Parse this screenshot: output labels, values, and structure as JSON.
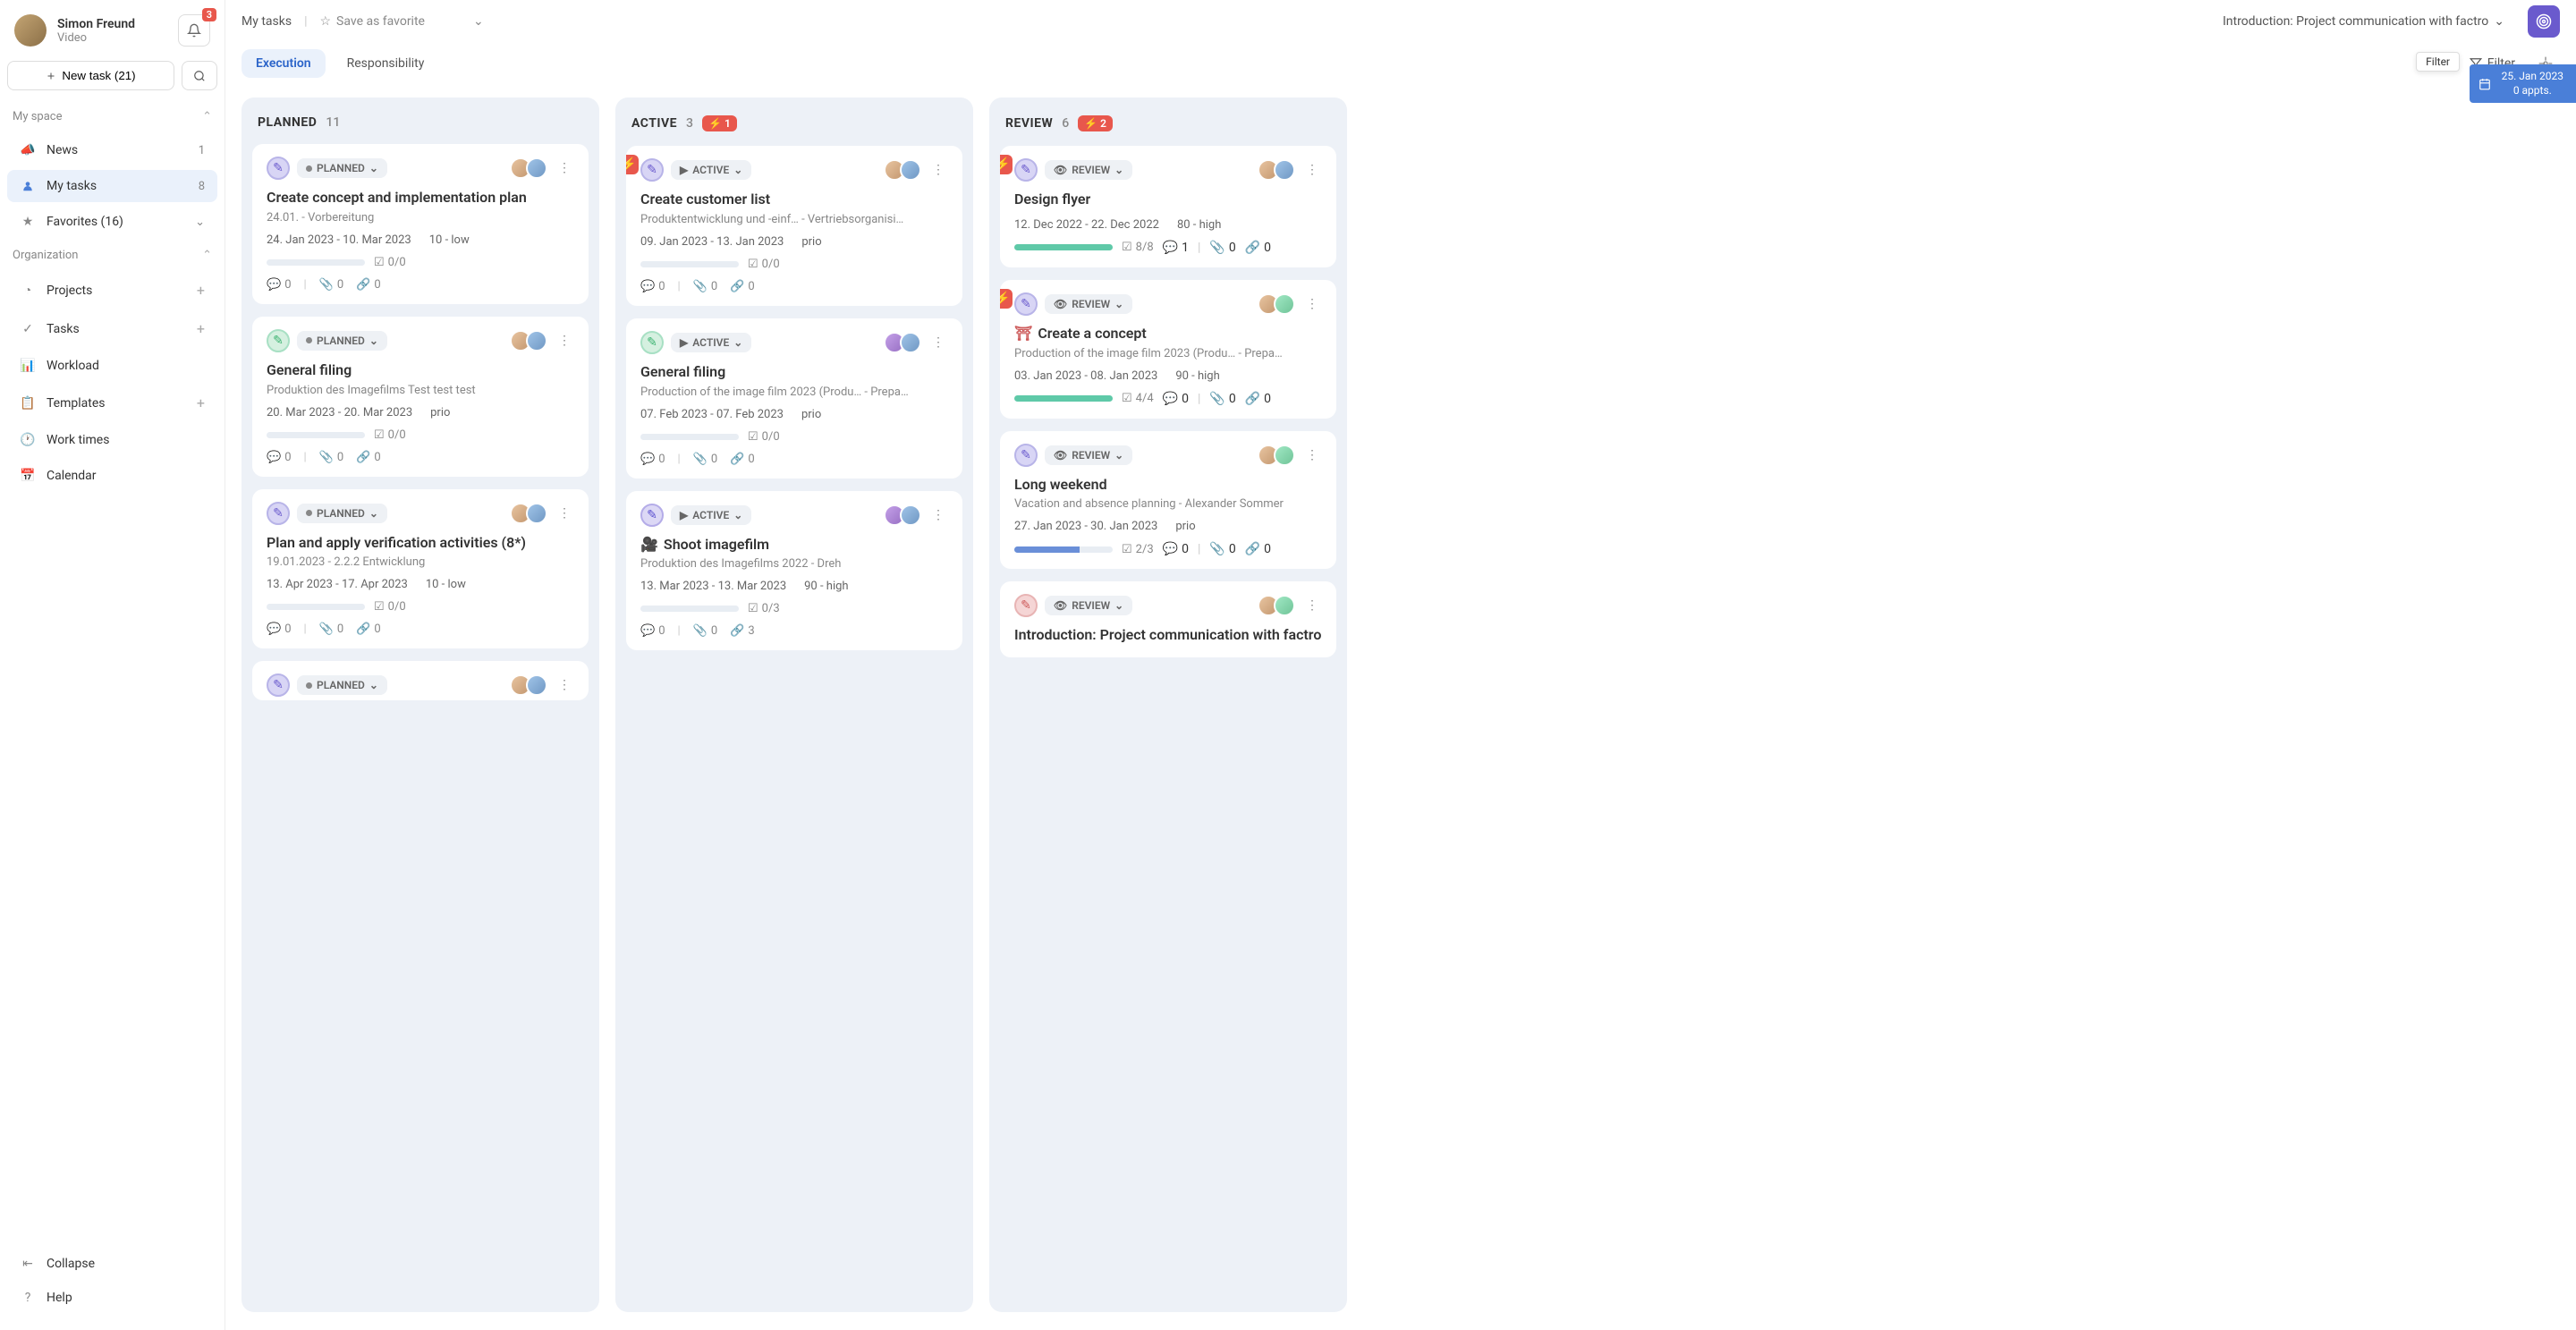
{
  "user": {
    "name": "Simon Freund",
    "subtitle": "Video",
    "bell_badge": "3"
  },
  "sidebar": {
    "new_task": "New task (21)",
    "sections": {
      "my_space": {
        "title": "My space"
      },
      "organization": {
        "title": "Organization"
      }
    },
    "items": {
      "news": {
        "label": "News",
        "badge": "1"
      },
      "my_tasks": {
        "label": "My tasks",
        "badge": "8"
      },
      "favorites": {
        "label": "Favorites (16)"
      },
      "projects": {
        "label": "Projects"
      },
      "tasks": {
        "label": "Tasks"
      },
      "workload": {
        "label": "Workload"
      },
      "templates": {
        "label": "Templates"
      },
      "work_times": {
        "label": "Work times"
      },
      "calendar": {
        "label": "Calendar"
      },
      "collapse": {
        "label": "Collapse"
      },
      "help": {
        "label": "Help"
      }
    }
  },
  "topbar": {
    "crumb": "My tasks",
    "save_favorite": "Save as favorite",
    "board_title": "Introduction: Project communication with factro"
  },
  "tabs": {
    "execution": "Execution",
    "responsibility": "Responsibility"
  },
  "filter": {
    "label": "Filter",
    "tooltip": "Filter"
  },
  "date_panel": {
    "date": "25. Jan 2023",
    "appts": "0 appts."
  },
  "columns": {
    "planned": {
      "title": "PLANNED",
      "count": "11",
      "status_label": "PLANNED"
    },
    "active": {
      "title": "ACTIVE",
      "count": "3",
      "alert": "1",
      "status_label": "ACTIVE"
    },
    "review": {
      "title": "REVIEW",
      "count": "6",
      "alert": "2",
      "status_label": "REVIEW"
    }
  },
  "cards": {
    "p1": {
      "title": "Create concept and implementation plan",
      "sub": "24.01. - Vorbereitung",
      "dates": "24. Jan 2023 - 10. Mar 2023",
      "prio": "10 - low",
      "check": "0/0",
      "comments": "0",
      "attach": "0",
      "links": "0"
    },
    "p2": {
      "title": "General filing",
      "sub": "Produktion des Imagefilms Test test test",
      "dates": "20. Mar 2023 - 20. Mar 2023",
      "prio": "prio",
      "check": "0/0",
      "comments": "0",
      "attach": "0",
      "links": "0"
    },
    "p3": {
      "title": "Plan and apply verification activities (8*)",
      "sub": "19.01.2023 - 2.2.2 Entwicklung",
      "dates": "13. Apr 2023 - 17. Apr 2023",
      "prio": "10 - low",
      "check": "0/0",
      "comments": "0",
      "attach": "0",
      "links": "0"
    },
    "a1": {
      "title": "Create customer list",
      "sub": "Produktentwicklung und -einf…  - Vertriebsorganisi…",
      "dates": "09. Jan 2023 - 13. Jan 2023",
      "prio": "prio",
      "check": "0/0",
      "comments": "0",
      "attach": "0",
      "links": "0"
    },
    "a2": {
      "title": "General filing",
      "sub": "Production of the image film 2023 (Produ…  - Prepa…",
      "dates": "07. Feb 2023 - 07. Feb 2023",
      "prio": "prio",
      "check": "0/0",
      "comments": "0",
      "attach": "0",
      "links": "0"
    },
    "a3": {
      "title": "Shoot imagefilm",
      "sub": "Produktion des Imagefilms 2022 - Dreh",
      "dates": "13. Mar 2023 - 13. Mar 2023",
      "prio": "90 - high",
      "check": "0/3",
      "comments": "0",
      "attach": "0",
      "links": "3"
    },
    "r1": {
      "title": "Design flyer",
      "dates": "12. Dec 2022 - 22. Dec 2022",
      "prio": "80 - high",
      "check": "8/8",
      "comments": "1",
      "attach": "0",
      "links": "0"
    },
    "r2": {
      "title": "Create a concept",
      "sub": "Production of the image film 2023 (Produ…  - Prepa…",
      "dates": "03. Jan 2023 - 08. Jan 2023",
      "prio": "90 - high",
      "check": "4/4",
      "comments": "0",
      "attach": "0",
      "links": "0"
    },
    "r3": {
      "title": "Long weekend",
      "sub": "Vacation and absence planning - Alexander Sommer",
      "dates": "27. Jan 2023 - 30. Jan 2023",
      "prio": "prio",
      "check": "2/3",
      "comments": "0",
      "attach": "0",
      "links": "0"
    },
    "r4": {
      "title": "Introduction: Project communication with factro"
    }
  }
}
